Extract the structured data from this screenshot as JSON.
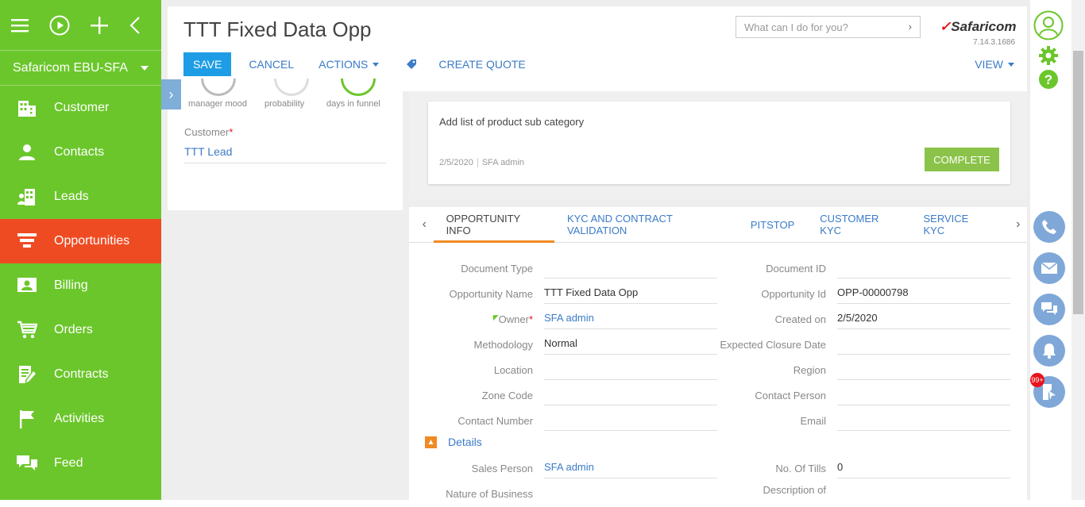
{
  "sidebar": {
    "org_name": "Safaricom EBU-SFA",
    "items": [
      {
        "label": "Customer",
        "icon": "building-icon"
      },
      {
        "label": "Contacts",
        "icon": "person-icon"
      },
      {
        "label": "Leads",
        "icon": "building-people-icon"
      },
      {
        "label": "Opportunities",
        "icon": "funnel-icon",
        "active": true
      },
      {
        "label": "Billing",
        "icon": "id-card-icon"
      },
      {
        "label": "Orders",
        "icon": "cart-icon"
      },
      {
        "label": "Contracts",
        "icon": "contract-icon"
      },
      {
        "label": "Activities",
        "icon": "flag-icon"
      },
      {
        "label": "Feed",
        "icon": "chat-icon"
      }
    ]
  },
  "header": {
    "title": "TTT Fixed Data Opp",
    "save_label": "SAVE",
    "cancel_label": "CANCEL",
    "actions_label": "ACTIONS",
    "create_quote_label": "CREATE QUOTE",
    "view_label": "VIEW",
    "search_placeholder": "What can I do for you?",
    "brand": "Safaricom",
    "version": "7.14.3.1686"
  },
  "metrics": {
    "manager_mood": "manager mood",
    "probability": "probability",
    "days_in_funnel": "days in funnel"
  },
  "customer": {
    "label": "Customer",
    "required_mark": "*",
    "value": "TTT Lead"
  },
  "task": {
    "text": "Add list of product sub category",
    "date": "2/5/2020",
    "author": "SFA admin",
    "complete_label": "COMPLETE"
  },
  "tabs": [
    "OPPORTUNITY INFO",
    "KYC AND CONTRACT VALIDATION",
    "PITSTOP",
    "CUSTOMER KYC",
    "SERVICE KYC"
  ],
  "fields": {
    "document_type_label": "Document Type",
    "document_type": "",
    "document_id_label": "Document ID",
    "document_id": "",
    "opportunity_name_label": "Opportunity Name",
    "opportunity_name": "TTT Fixed Data Opp",
    "opportunity_id_label": "Opportunity Id",
    "opportunity_id": "OPP-00000798",
    "owner_label": "Owner",
    "owner": "SFA admin",
    "created_on_label": "Created on",
    "created_on": "2/5/2020",
    "methodology_label": "Methodology",
    "methodology": "Normal",
    "expected_closure_label": "Expected Closure Date",
    "expected_closure": "",
    "location_label": "Location",
    "location": "",
    "region_label": "Region",
    "region": "",
    "zone_code_label": "Zone Code",
    "zone_code": "",
    "contact_person_label": "Contact Person",
    "contact_person": "",
    "contact_number_label": "Contact Number",
    "contact_number": "",
    "email_label": "Email",
    "email": ""
  },
  "details": {
    "title": "Details",
    "sales_person_label": "Sales Person",
    "sales_person": "SFA admin",
    "no_of_tills_label": "No. Of Tills",
    "no_of_tills": "0",
    "nature_of_business_label": "Nature of Business",
    "description_label": "Description of"
  },
  "rail": {
    "notification_count": "99+"
  },
  "colors": {
    "sidebar": "#6bc62b",
    "active": "#ef4b23",
    "primary": "#1e9de6",
    "link": "#3b7bc8",
    "complete": "#8bc34a"
  }
}
